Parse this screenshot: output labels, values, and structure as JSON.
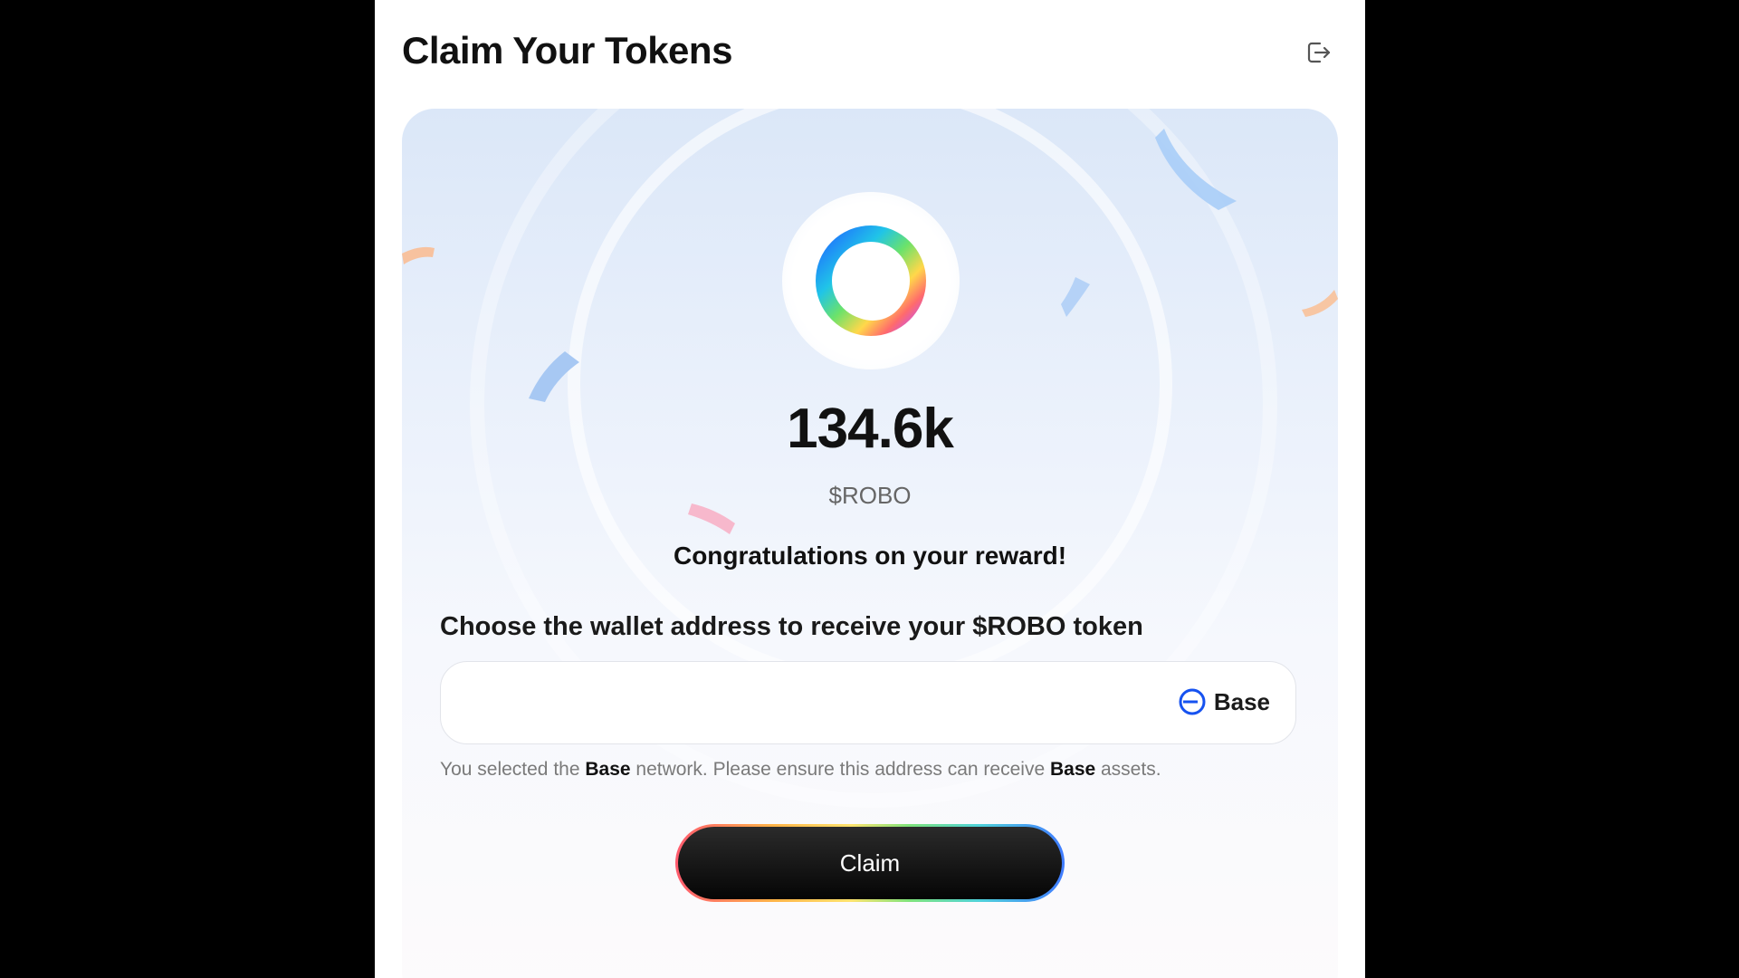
{
  "header": {
    "title": "Claim Your Tokens",
    "logout_icon": "logout-icon"
  },
  "reward": {
    "amount": "134.6k",
    "ticker": "$ROBO",
    "message": "Congratulations on your reward!",
    "token_icon": "rainbow-ring-icon"
  },
  "wallet": {
    "prompt": "Choose the wallet address to receive your $ROBO token",
    "address_value": "",
    "network_label": "Base",
    "network_icon": "base-network-icon",
    "note_prefix": "You selected the ",
    "note_network_1": "Base",
    "note_middle": " network. Please ensure this address can receive ",
    "note_network_2": "Base",
    "note_suffix": " assets."
  },
  "actions": {
    "claim_label": "Claim"
  },
  "colors": {
    "background": "#000000",
    "panel": "#ffffff",
    "base_blue": "#1652f0",
    "button": "#111111"
  }
}
